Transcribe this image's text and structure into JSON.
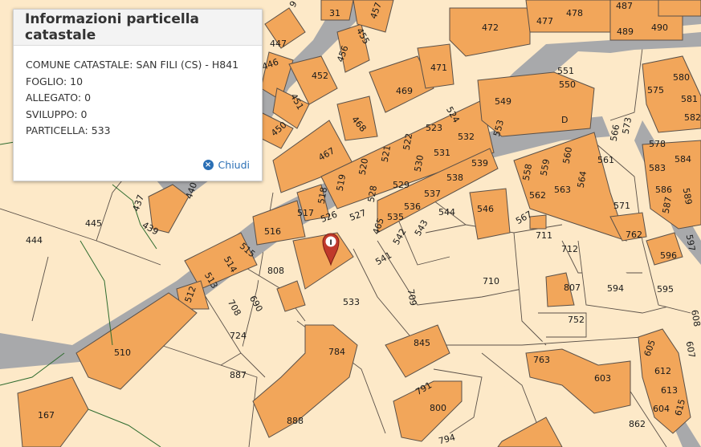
{
  "popup": {
    "title": "Informazioni particella catastale",
    "lines": [
      "COMUNE CATASTALE: SAN FILI (CS) - H841",
      "FOGLIO: 10",
      "ALLEGATO: 0",
      "SVILUPPO: 0",
      "PARTICELLA: 533"
    ],
    "close_label": "Chiudi",
    "close_icon": "close-icon"
  },
  "colors": {
    "land": "#fde9c8",
    "building": "#f2a65a",
    "road": "#a8a9ab",
    "boundary": "#5a5048",
    "marker": "#c0392b",
    "link": "#2a6fb5"
  },
  "map": {
    "marker_letter": "I",
    "parcels": {
      "p444": "444",
      "p445": "445",
      "p437": "437",
      "p439": "439",
      "p440": "440",
      "p447": "447",
      "p446": "446",
      "p451": "451",
      "p450": "450",
      "p452": "452",
      "p456": "456",
      "p455": "455",
      "p457": "457",
      "p31": "31",
      "p9": "9",
      "p472": "472",
      "p477": "477",
      "p478": "478",
      "p487": "487",
      "p489": "489",
      "p490": "490",
      "p469": "469",
      "p471": "471",
      "p468": "468",
      "p467": "467",
      "p524": "524",
      "p523": "523",
      "p532": "532",
      "p531": "531",
      "p522": "522",
      "p521": "521",
      "p520": "520",
      "p519": "519",
      "p518": "518",
      "p517": "517",
      "p526": "526",
      "p527": "527",
      "p528": "528",
      "p529": "529",
      "p530": "530",
      "p539": "539",
      "p538": "538",
      "p537": "537",
      "p536": "536",
      "p535": "535",
      "p465": "465",
      "p543": "543",
      "p542": "542",
      "p541": "541",
      "p544": "544",
      "p546": "546",
      "p549": "549",
      "p553": "553",
      "p550": "550",
      "p551": "551",
      "pD": "D",
      "p566": "566",
      "p573": "573",
      "p578": "578",
      "p558": "558",
      "p559": "559",
      "p560": "560",
      "p561": "561",
      "p562": "562",
      "p563": "563",
      "p564": "564",
      "p571": "571",
      "p567": "567",
      "p711": "711",
      "p712": "712",
      "p762": "762",
      "p575": "575",
      "p580": "580",
      "p581": "581",
      "p582": "582",
      "p583": "583",
      "p584": "584",
      "p586": "586",
      "p587": "587",
      "p589": "589",
      "p596": "596",
      "p597": "597",
      "p516": "516",
      "p515": "515",
      "p514": "514",
      "p513": "513",
      "p512": "512",
      "p510": "510",
      "p808": "808",
      "p690": "690",
      "p708": "708",
      "p724": "724",
      "p533": "533",
      "p709": "709",
      "p710": "710",
      "p807": "807",
      "p594": "594",
      "p595": "595",
      "p752": "752",
      "p887": "887",
      "p784": "784",
      "p845": "845",
      "p888": "888",
      "p791": "791",
      "p800": "800",
      "p794": "794",
      "p763": "763",
      "p603": "603",
      "p862": "862",
      "p605": "605",
      "p612": "612",
      "p613": "613",
      "p615": "615",
      "p604": "604",
      "p607": "607",
      "p608": "608",
      "p167": "167"
    }
  }
}
